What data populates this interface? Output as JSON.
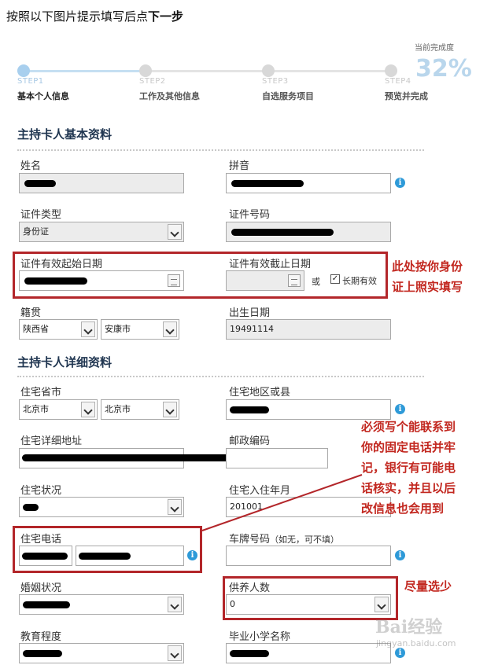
{
  "instruction": {
    "pre": "按照以下图片提示填写后点",
    "bold": "下一步"
  },
  "progress": {
    "label": "当前完成度",
    "percent": "32%",
    "fraction": 0.32
  },
  "steps": [
    {
      "num": "STEP1",
      "name": "基本个人信息"
    },
    {
      "num": "STEP2",
      "name": "工作及其他信息"
    },
    {
      "num": "STEP3",
      "name": "自选服务项目"
    },
    {
      "num": "STEP4",
      "name": "预览并完成"
    }
  ],
  "section1": {
    "title": "主持卡人基本资料",
    "name_label": "姓名",
    "pinyin_label": "拼音",
    "id_type_label": "证件类型",
    "id_type_value": "身份证",
    "id_number_label": "证件号码",
    "id_start_label": "证件有效起始日期",
    "id_end_label": "证件有效截止日期",
    "or_text": "或",
    "long_term_label": "长期有效",
    "native_label": "籍贯",
    "province_value": "陕西省",
    "city_value": "安康市",
    "birth_label": "出生日期",
    "birth_value": "19491114"
  },
  "section2": {
    "title": "主持卡人详细资料",
    "home_province_label": "住宅省市",
    "home_province_value": "北京市",
    "home_city_value": "北京市",
    "home_district_label": "住宅地区或县",
    "home_address_label": "住宅详细地址",
    "postcode_label": "邮政编码",
    "home_status_label": "住宅状况",
    "move_in_label": "住宅入住年月",
    "move_in_value": "201001",
    "home_phone_label": "住宅电话",
    "plate_label": "车牌号码",
    "plate_hint": "（如无，可不填）",
    "marital_label": "婚姻状况",
    "dependents_label": "供养人数",
    "dependents_value": "0",
    "education_label": "教育程度",
    "school_label": "毕业小学名称"
  },
  "notes": {
    "id_note_line1": "此处按你身份",
    "id_note_line2": "证上照实填写",
    "phone_note_line1": "必须写个能联系到",
    "phone_note_line2": "你的固定电话并牢",
    "phone_note_line3": "记，银行有可能电",
    "phone_note_line4": "话核实，并且以后",
    "phone_note_line5": "改信息也会用到",
    "dependents_note": "尽量选少"
  },
  "watermark": {
    "logo": "Bai经验",
    "sub": "jingyan.baidu.com"
  },
  "colors": {
    "red_annotation": "#b3262a",
    "title": "#1f3550",
    "info_icon": "#2e9ad8",
    "progress": "#a8cfee"
  }
}
